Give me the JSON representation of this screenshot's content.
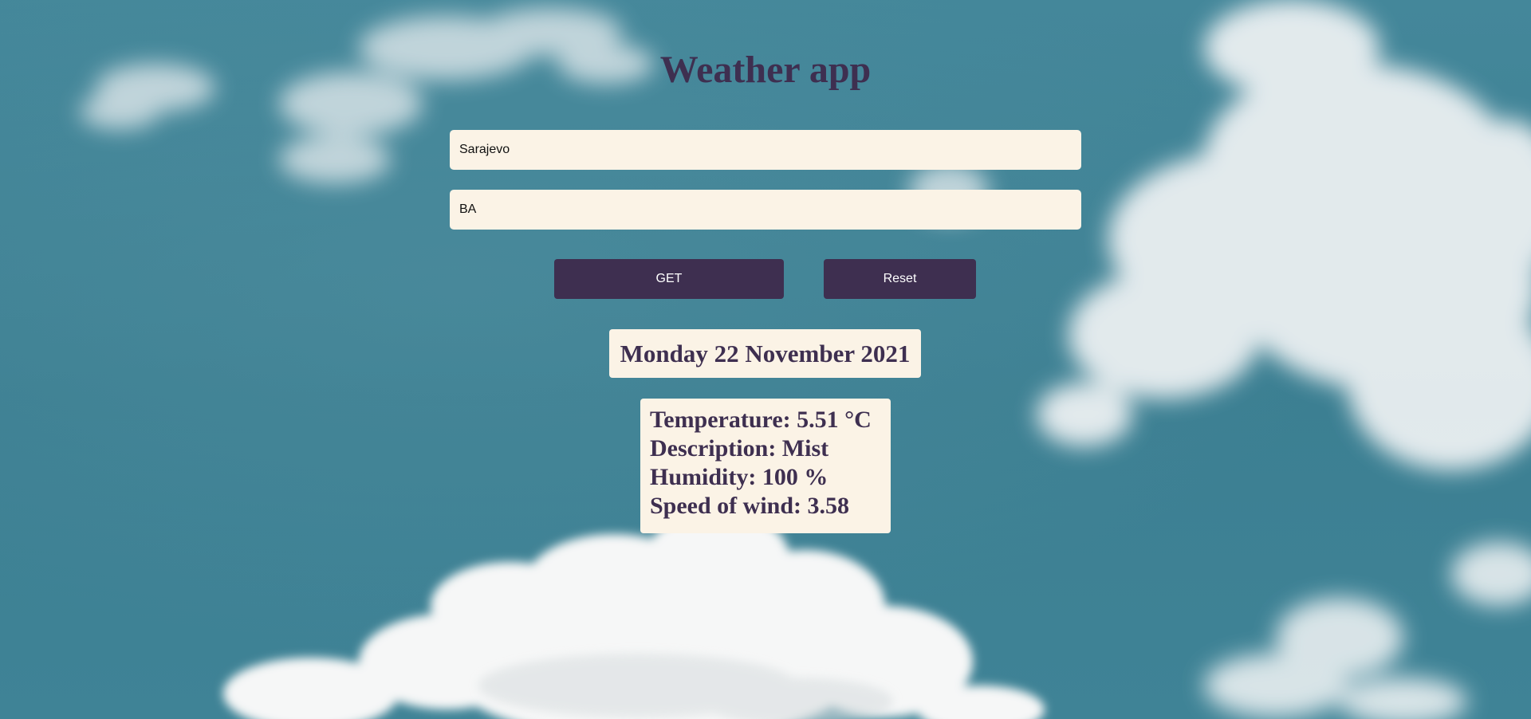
{
  "app": {
    "title": "Weather app"
  },
  "form": {
    "city_value": "Sarajevo",
    "country_value": "BA",
    "get_label": "GET",
    "reset_label": "Reset"
  },
  "result": {
    "date": "Monday 22 November 2021",
    "temperature": "Temperature: 5.51 °C",
    "description": "Description: Mist",
    "humidity": "Humidity: 100 %",
    "wind": "Speed of wind: 3.58"
  },
  "theme": {
    "sky_color": "#3f8294",
    "accent_color": "#3e2f50",
    "card_color": "#fbf3e6",
    "cloud_color": "#eef1f2"
  }
}
